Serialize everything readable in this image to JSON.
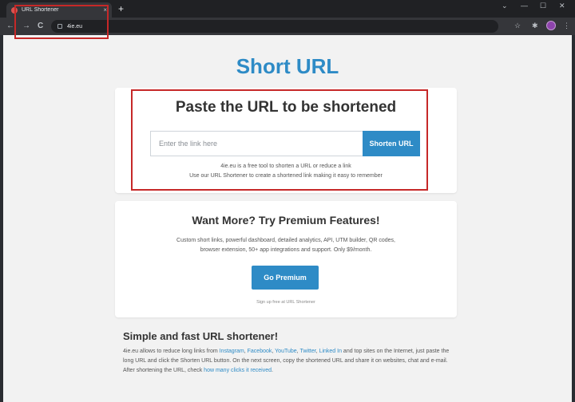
{
  "browser": {
    "tab_title": "URL Shortener",
    "tab_close": "×",
    "new_tab": "+",
    "url": "4ie.eu",
    "window_controls": {
      "chevron": "⌄",
      "minimize": "—",
      "maximize": "☐",
      "close": "✕"
    },
    "nav": {
      "back": "←",
      "forward": "→",
      "reload": "C"
    },
    "toolbar_icons": {
      "star": "☆",
      "extensions": "✱",
      "menu": "⋮"
    }
  },
  "page": {
    "site_title": "Short URL",
    "shorten_card": {
      "heading": "Paste the URL to be shortened",
      "input_placeholder": "Enter the link here",
      "button_label": "Shorten URL",
      "desc_line1": "4ie.eu is a free tool to shorten a URL or reduce a link",
      "desc_line2": "Use our URL Shortener to create a shortened link making it easy to remember"
    },
    "premium_card": {
      "heading": "Want More? Try Premium Features!",
      "feature_line1": "Custom short links, powerful dashboard, detailed analytics, API, UTM builder, QR codes,",
      "feature_line2": "browser extension, 50+ app integrations and support. Only $9/month.",
      "button_label": "Go Premium",
      "signup_text": "Sign up free at URL Shortener"
    },
    "about": {
      "heading": "Simple and fast URL shortener!",
      "text_1": "4ie.eu allows to reduce long links from ",
      "link_instagram": "Instagram",
      "sep1": ", ",
      "link_facebook": "Facebook",
      "sep2": ", ",
      "link_youtube": "YouTube",
      "sep3": ", ",
      "link_twitter": "Twitter",
      "sep4": ", ",
      "link_linkedin": "Linked In",
      "text_2": " and top sites on the Internet, just paste the long URL and click the Shorten URL button. On the next screen, copy the shortened URL and share it on websites, chat and e-mail. After shortening the URL, check ",
      "link_clicks": "how many clicks it received",
      "text_3": "."
    }
  },
  "colors": {
    "brand_blue": "#2e8bc6",
    "highlight_red": "#c62828"
  }
}
